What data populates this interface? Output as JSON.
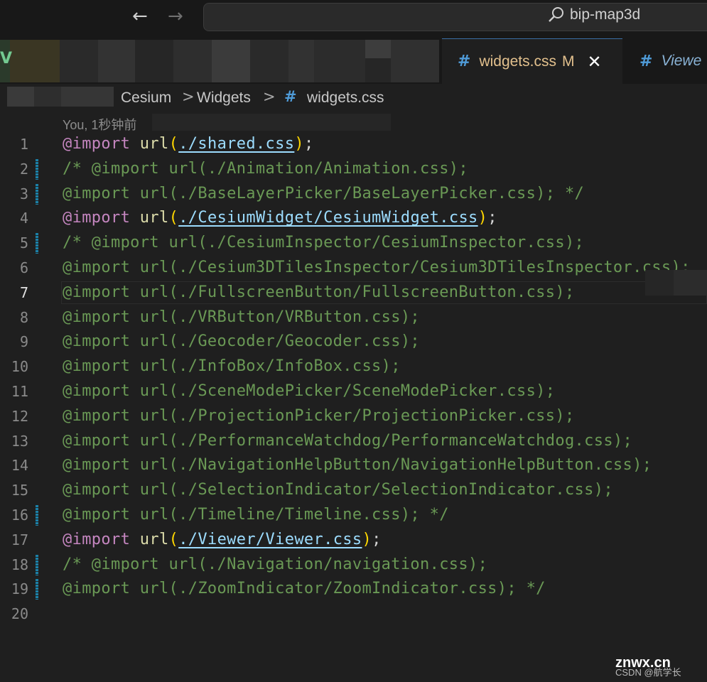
{
  "search": {
    "text": "bip-map3d"
  },
  "tabs": [
    {
      "hash": "#",
      "name": "widgets.css",
      "badge": "M",
      "close": "✕"
    },
    {
      "hash": "#",
      "name": "Viewe"
    }
  ],
  "breadcrumb": {
    "items": [
      "Cesium",
      "Widgets"
    ],
    "separator": ">",
    "file_hash": "#",
    "file": "widgets.css"
  },
  "blame": "You, 1秒钟前",
  "lines": [
    {
      "n": "1",
      "mark": "",
      "segments": [
        {
          "t": "@import",
          "c": "kw"
        },
        {
          "t": " ",
          "c": "punc"
        },
        {
          "t": "url",
          "c": "fn"
        },
        {
          "t": "(",
          "c": "br"
        },
        {
          "t": "./shared.css",
          "c": "path"
        },
        {
          "t": ")",
          "c": "br"
        },
        {
          "t": ";",
          "c": "punc"
        }
      ]
    },
    {
      "n": "2",
      "mark": "mod",
      "segments": [
        {
          "t": "/* @import url(./Animation/Animation.css);",
          "c": "cm"
        }
      ]
    },
    {
      "n": "3",
      "mark": "mod",
      "segments": [
        {
          "t": "@import url(./BaseLayerPicker/BaseLayerPicker.css); */",
          "c": "cm"
        }
      ]
    },
    {
      "n": "4",
      "mark": "",
      "segments": [
        {
          "t": "@import",
          "c": "kw"
        },
        {
          "t": " ",
          "c": "punc"
        },
        {
          "t": "url",
          "c": "fn"
        },
        {
          "t": "(",
          "c": "br"
        },
        {
          "t": "./CesiumWidget/CesiumWidget.css",
          "c": "path"
        },
        {
          "t": ")",
          "c": "br"
        },
        {
          "t": ";",
          "c": "punc"
        }
      ]
    },
    {
      "n": "5",
      "mark": "mod",
      "segments": [
        {
          "t": "/* @import url(./CesiumInspector/CesiumInspector.css);",
          "c": "cm"
        }
      ]
    },
    {
      "n": "6",
      "mark": "",
      "segments": [
        {
          "t": "@import url(./Cesium3DTilesInspector/Cesium3DTilesInspector.css);",
          "c": "cm"
        }
      ]
    },
    {
      "n": "7",
      "mark": "",
      "active": true,
      "segments": [
        {
          "t": "@import url(./FullscreenButton/FullscreenButton.css);",
          "c": "cm"
        }
      ]
    },
    {
      "n": "8",
      "mark": "",
      "segments": [
        {
          "t": "@import url(./VRButton/VRButton.css);",
          "c": "cm"
        }
      ]
    },
    {
      "n": "9",
      "mark": "",
      "segments": [
        {
          "t": "@import url(./Geocoder/Geocoder.css);",
          "c": "cm"
        }
      ]
    },
    {
      "n": "10",
      "mark": "",
      "segments": [
        {
          "t": "@import url(./InfoBox/InfoBox.css);",
          "c": "cm"
        }
      ]
    },
    {
      "n": "11",
      "mark": "",
      "segments": [
        {
          "t": "@import url(./SceneModePicker/SceneModePicker.css);",
          "c": "cm"
        }
      ]
    },
    {
      "n": "12",
      "mark": "",
      "segments": [
        {
          "t": "@import url(./ProjectionPicker/ProjectionPicker.css);",
          "c": "cm"
        }
      ]
    },
    {
      "n": "13",
      "mark": "",
      "segments": [
        {
          "t": "@import url(./PerformanceWatchdog/PerformanceWatchdog.css);",
          "c": "cm"
        }
      ]
    },
    {
      "n": "14",
      "mark": "",
      "segments": [
        {
          "t": "@import url(./NavigationHelpButton/NavigationHelpButton.css);",
          "c": "cm"
        }
      ]
    },
    {
      "n": "15",
      "mark": "",
      "segments": [
        {
          "t": "@import url(./SelectionIndicator/SelectionIndicator.css);",
          "c": "cm"
        }
      ]
    },
    {
      "n": "16",
      "mark": "mod",
      "segments": [
        {
          "t": "@import url(./Timeline/Timeline.css); */",
          "c": "cm"
        }
      ]
    },
    {
      "n": "17",
      "mark": "",
      "segments": [
        {
          "t": "@import",
          "c": "kw"
        },
        {
          "t": " ",
          "c": "punc"
        },
        {
          "t": "url",
          "c": "fn"
        },
        {
          "t": "(",
          "c": "br"
        },
        {
          "t": "./Viewer/Viewer.css",
          "c": "path"
        },
        {
          "t": ")",
          "c": "br"
        },
        {
          "t": ";",
          "c": "punc"
        }
      ]
    },
    {
      "n": "18",
      "mark": "mod",
      "segments": [
        {
          "t": "/* @import url(./Navigation/navigation.css);",
          "c": "cm"
        }
      ]
    },
    {
      "n": "19",
      "mark": "mod",
      "segments": [
        {
          "t": "@import url(./ZoomIndicator/ZoomIndicator.css); */",
          "c": "cm"
        }
      ]
    },
    {
      "n": "20",
      "mark": "",
      "segments": []
    }
  ],
  "watermark": {
    "main": "znwx.cn",
    "sub": "CSDN @航学长"
  },
  "colors": {
    "comment": "#6a9955",
    "keyword": "#c586c0",
    "function": "#dcdcaa",
    "path": "#9cdcfe",
    "bracket": "#ffd700",
    "gutter_modified": "#1b81a8",
    "tab_modified": "#e2c08d"
  }
}
